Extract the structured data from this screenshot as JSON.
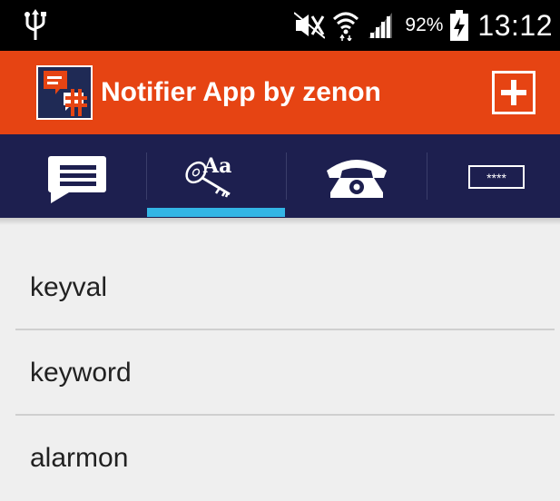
{
  "status_bar": {
    "battery_percent": "92%",
    "time": "13:12",
    "icons": [
      "usb-icon",
      "mute-icon",
      "wifi-icon",
      "signal-icon",
      "battery-charging-icon"
    ]
  },
  "app_bar": {
    "title": "Notifier App by zenon",
    "add_icon": "plus-box-icon",
    "logo_icon": "app-logo-icon"
  },
  "tabs": [
    {
      "icon": "message-icon",
      "selected": false
    },
    {
      "icon": "key-text-icon",
      "selected": true
    },
    {
      "icon": "phone-icon",
      "selected": false
    },
    {
      "icon": "password-icon",
      "selected": false,
      "text": "****"
    }
  ],
  "colors": {
    "app_bar": "#e64413",
    "tab_bar": "#1d1f4f",
    "tab_indicator": "#33b5e5",
    "background": "#efefef"
  },
  "list": {
    "items": [
      {
        "label": "keyval"
      },
      {
        "label": "keyword"
      },
      {
        "label": "alarmon"
      }
    ]
  }
}
